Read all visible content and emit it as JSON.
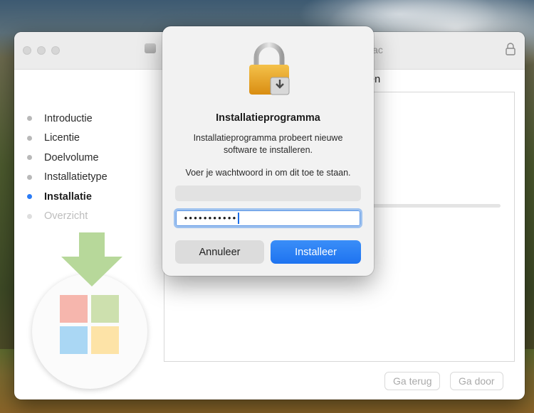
{
  "window": {
    "title_fragment": "lac",
    "section_title_fragment": "en"
  },
  "steps": [
    {
      "label": "Introductie",
      "state": "done"
    },
    {
      "label": "Licentie",
      "state": "done"
    },
    {
      "label": "Doelvolume",
      "state": "done"
    },
    {
      "label": "Installatietype",
      "state": "done"
    },
    {
      "label": "Installatie",
      "state": "active"
    },
    {
      "label": "Overzicht",
      "state": "future"
    }
  ],
  "nav": {
    "back_label": "Ga terug",
    "continue_label": "Ga door"
  },
  "dialog": {
    "title": "Installatieprogramma",
    "message": "Installatieprogramma probeert nieuwe software te installeren.",
    "prompt": "Voer je wachtwoord in om dit toe te staan.",
    "password_mask": "•••••••••••",
    "cancel_label": "Annuleer",
    "ok_label": "Installeer"
  },
  "colors": {
    "accent": "#1e73f0",
    "tile_red": "#f6b6ad",
    "tile_green": "#cde0ae",
    "tile_blue": "#aad7f4",
    "tile_yellow": "#fde3a7",
    "arrow_green": "#b7d89a"
  }
}
